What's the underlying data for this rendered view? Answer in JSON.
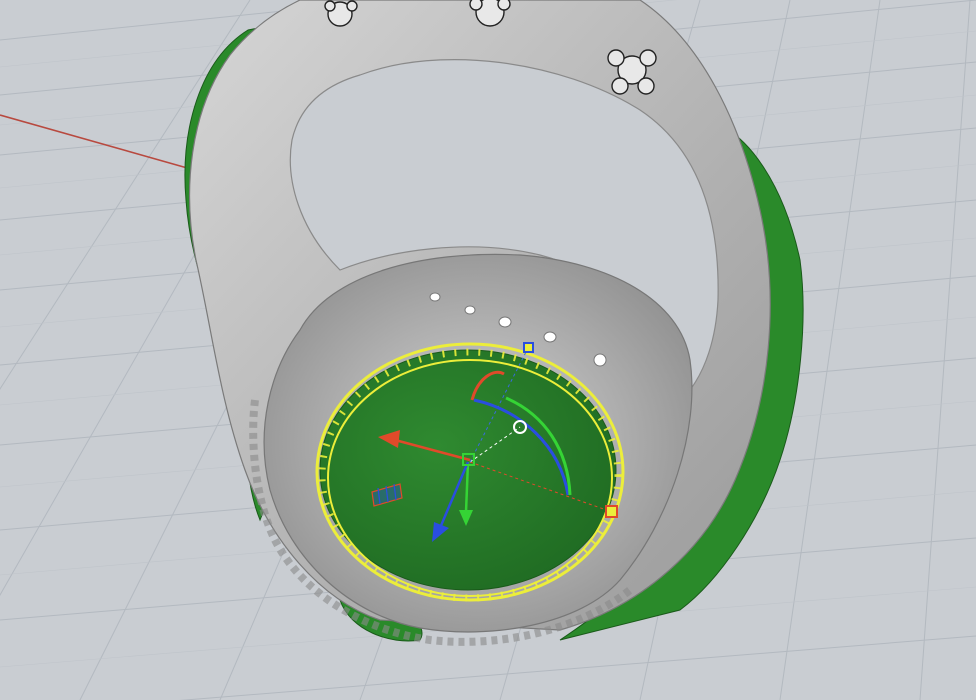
{
  "viewport": {
    "view": "perspective",
    "background_color": "#c9cdd2",
    "grid_color": "#aeb4bb",
    "x_axis_color": "#b8493f",
    "y_axis_color": "#3aa244"
  },
  "model": {
    "object": "ring",
    "metal_color": "#b4b4b4",
    "selection_color": "#2b8a2b",
    "highlight_color": "#ecee3a"
  },
  "gizmo": {
    "x_arrow_color": "#e04a2a",
    "y_arrow_color": "#35d435",
    "z_arrow_color": "#2a4ee0",
    "rotate_arc_colors": [
      "#e04a2a",
      "#2a4ee0",
      "#35d435"
    ],
    "handles": [
      "center-handle",
      "rotate-handle",
      "scale-handle",
      "top-handle"
    ]
  }
}
